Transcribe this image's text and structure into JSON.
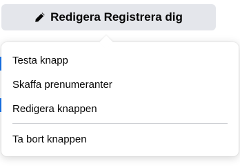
{
  "edit_button": {
    "label": "Redigera Registrera dig",
    "icon": "pencil-icon"
  },
  "menu": {
    "items": [
      {
        "label": "Testa knapp"
      },
      {
        "label": "Skaffa prenumeranter"
      },
      {
        "label": "Redigera knappen"
      }
    ],
    "danger_items": [
      {
        "label": "Ta bort knappen"
      }
    ]
  },
  "colors": {
    "button_bg": "#e4e6eb",
    "text": "#050505",
    "divider": "#ced0d4",
    "accent_edge": "#1877f2"
  }
}
